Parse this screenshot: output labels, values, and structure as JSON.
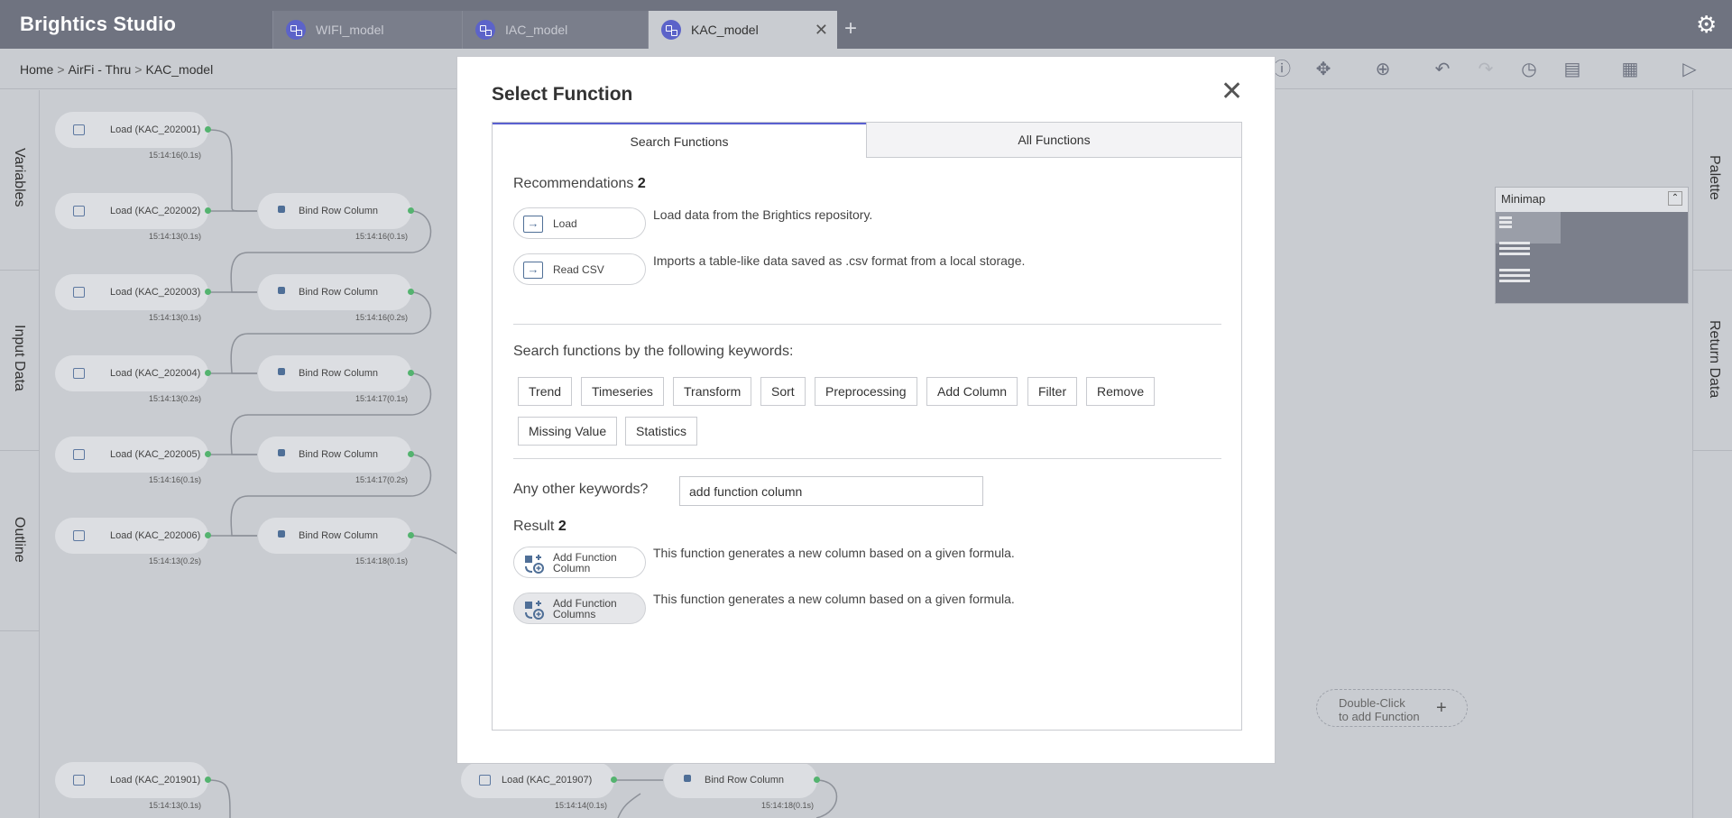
{
  "app": {
    "title": "Brightics Studio"
  },
  "tabs": [
    {
      "label": "WIFI_model"
    },
    {
      "label": "IAC_model"
    },
    {
      "label": "KAC_model"
    }
  ],
  "breadcrumb": {
    "home": "Home",
    "project": "AirFi - Thru",
    "model": "KAC_model",
    "separator": ">"
  },
  "left_rail": [
    "Variables",
    "Input Data",
    "Outline"
  ],
  "right_rail": [
    "Palette",
    "Return Data"
  ],
  "minimap": {
    "title": "Minimap"
  },
  "canvas": {
    "load_nodes": [
      {
        "label": "Load (KAC_202001)",
        "time": "15:14:16(0.1s)"
      },
      {
        "label": "Load (KAC_202002)",
        "time": "15:14:13(0.1s)"
      },
      {
        "label": "Load (KAC_202003)",
        "time": "15:14:13(0.1s)"
      },
      {
        "label": "Load (KAC_202004)",
        "time": "15:14:13(0.2s)"
      },
      {
        "label": "Load (KAC_202005)",
        "time": "15:14:16(0.1s)"
      },
      {
        "label": "Load (KAC_202006)",
        "time": "15:14:13(0.2s)"
      },
      {
        "label": "Load (KAC_201901)",
        "time": "15:14:13(0.1s)"
      },
      {
        "label": "Load (KAC_201907)",
        "time": "15:14:14(0.1s)"
      }
    ],
    "bind_nodes": [
      {
        "label": "Bind Row Column",
        "time": "15:14:16(0.1s)"
      },
      {
        "label": "Bind Row Column",
        "time": "15:14:16(0.2s)"
      },
      {
        "label": "Bind Row Column",
        "time": "15:14:17(0.1s)"
      },
      {
        "label": "Bind Row Column",
        "time": "15:14:17(0.2s)"
      },
      {
        "label": "Bind Row Column",
        "time": "15:14:18(0.1s)"
      },
      {
        "label": "Bind Row Column",
        "time": "15:14:18(0.1s)"
      }
    ],
    "add_function_hint": {
      "line1": "Double-Click",
      "line2": "to add Function",
      "plus": "+"
    }
  },
  "modal": {
    "title": "Select Function",
    "close": "✕",
    "tabs": {
      "search": "Search Functions",
      "all": "All Functions"
    },
    "recommendations": {
      "label": "Recommendations",
      "count": "2",
      "items": [
        {
          "name": "Load",
          "description": "Load data from the Brightics repository."
        },
        {
          "name": "Read CSV",
          "description": "Imports a table-like data saved as .csv format from a local storage."
        }
      ]
    },
    "keywords": {
      "label": "Search functions by the following keywords:",
      "items": [
        "Trend",
        "Timeseries",
        "Transform",
        "Sort",
        "Preprocessing",
        "Add Column",
        "Filter",
        "Remove",
        "Missing Value",
        "Statistics"
      ]
    },
    "other": {
      "label": "Any other keywords?",
      "value": "add function column"
    },
    "result": {
      "label": "Result",
      "count": "2",
      "items": [
        {
          "line1": "Add Function",
          "line2": "Column",
          "description": "This function generates a new column based on a given formula."
        },
        {
          "line1": "Add Function",
          "line2": "Columns",
          "description": "This function generates a new column based on a given formula."
        }
      ]
    }
  }
}
